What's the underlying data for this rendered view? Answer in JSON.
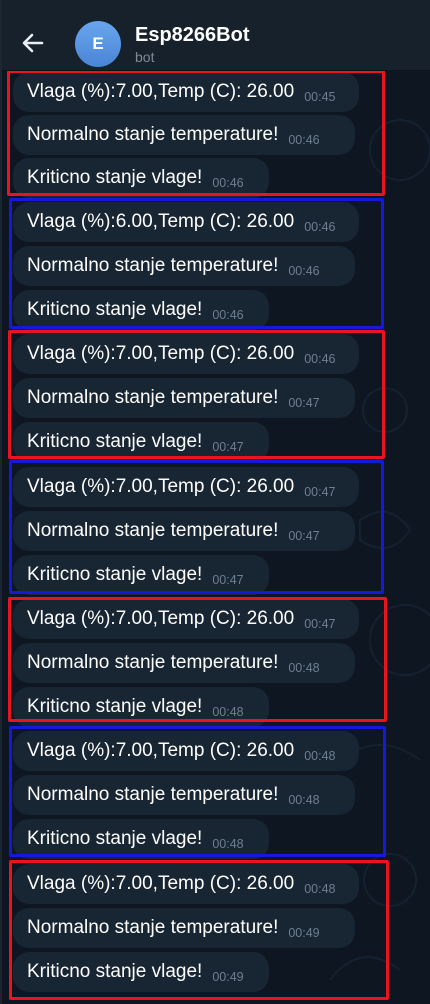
{
  "header": {
    "back_icon": "arrow-left-icon",
    "avatar_letter": "E",
    "title": "Esp8266Bot",
    "subtitle": "bot"
  },
  "colors": {
    "background": "#0e1621",
    "header": "#17212b",
    "bubble": "#182533",
    "avatar": "#5b95e3",
    "highlight_red": "#e8141f",
    "highlight_blue": "#1619d8"
  },
  "groups": [
    {
      "highlight": "red",
      "messages": [
        {
          "text": "Vlaga (%):7.00,Temp (C): 26.00",
          "time": "00:45"
        },
        {
          "text": "Normalno stanje temperature!",
          "time": "00:46"
        },
        {
          "text": "Kriticno stanje vlage!",
          "time": "00:46"
        }
      ]
    },
    {
      "highlight": "blue",
      "messages": [
        {
          "text": "Vlaga (%):6.00,Temp (C): 26.00",
          "time": "00:46"
        },
        {
          "text": "Normalno stanje temperature!",
          "time": "00:46"
        },
        {
          "text": "Kriticno stanje vlage!",
          "time": "00:46"
        }
      ]
    },
    {
      "highlight": "red",
      "messages": [
        {
          "text": "Vlaga (%):7.00,Temp (C): 26.00",
          "time": "00:46"
        },
        {
          "text": "Normalno stanje temperature!",
          "time": "00:47"
        },
        {
          "text": "Kriticno stanje vlage!",
          "time": "00:47"
        }
      ]
    },
    {
      "highlight": "blue",
      "messages": [
        {
          "text": "Vlaga (%):7.00,Temp (C): 26.00",
          "time": "00:47"
        },
        {
          "text": "Normalno stanje temperature!",
          "time": "00:47"
        },
        {
          "text": "Kriticno stanje vlage!",
          "time": "00:47"
        }
      ]
    },
    {
      "highlight": "red",
      "messages": [
        {
          "text": "Vlaga (%):7.00,Temp (C): 26.00",
          "time": "00:47"
        },
        {
          "text": "Normalno stanje temperature!",
          "time": "00:48"
        },
        {
          "text": "Kriticno stanje vlage!",
          "time": "00:48"
        }
      ]
    },
    {
      "highlight": "blue",
      "messages": [
        {
          "text": "Vlaga (%):7.00,Temp (C): 26.00",
          "time": "00:48"
        },
        {
          "text": "Normalno stanje temperature!",
          "time": "00:48"
        },
        {
          "text": "Kriticno stanje vlage!",
          "time": "00:48"
        }
      ]
    },
    {
      "highlight": "red",
      "messages": [
        {
          "text": "Vlaga (%):7.00,Temp (C): 26.00",
          "time": "00:48"
        },
        {
          "text": "Normalno stanje temperature!",
          "time": "00:49"
        },
        {
          "text": "Kriticno stanje vlage!",
          "time": "00:49"
        }
      ]
    }
  ]
}
